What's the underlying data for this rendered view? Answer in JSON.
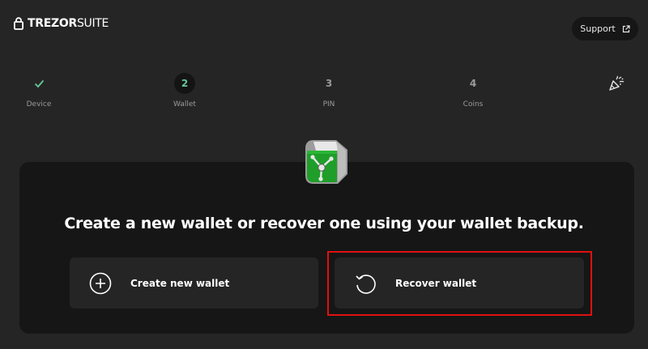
{
  "header": {
    "logo_brand": "TREZOR",
    "logo_product": "SUITE",
    "support_label": "Support"
  },
  "steps": [
    {
      "label": "Device",
      "marker": "",
      "state": "completed"
    },
    {
      "label": "Wallet",
      "marker": "2",
      "state": "active"
    },
    {
      "label": "PIN",
      "marker": "3",
      "state": "upcoming"
    },
    {
      "label": "Coins",
      "marker": "4",
      "state": "upcoming"
    }
  ],
  "main": {
    "headline": "Create a new wallet or recover one using your wallet backup.",
    "options": [
      {
        "label": "Create new wallet",
        "icon": "plus-circle-icon"
      },
      {
        "label": "Recover wallet",
        "icon": "recover-arrow-icon"
      }
    ]
  },
  "colors": {
    "background": "#252525",
    "card": "#161616",
    "accent_green": "#66c897",
    "highlight_red": "#e01010"
  }
}
